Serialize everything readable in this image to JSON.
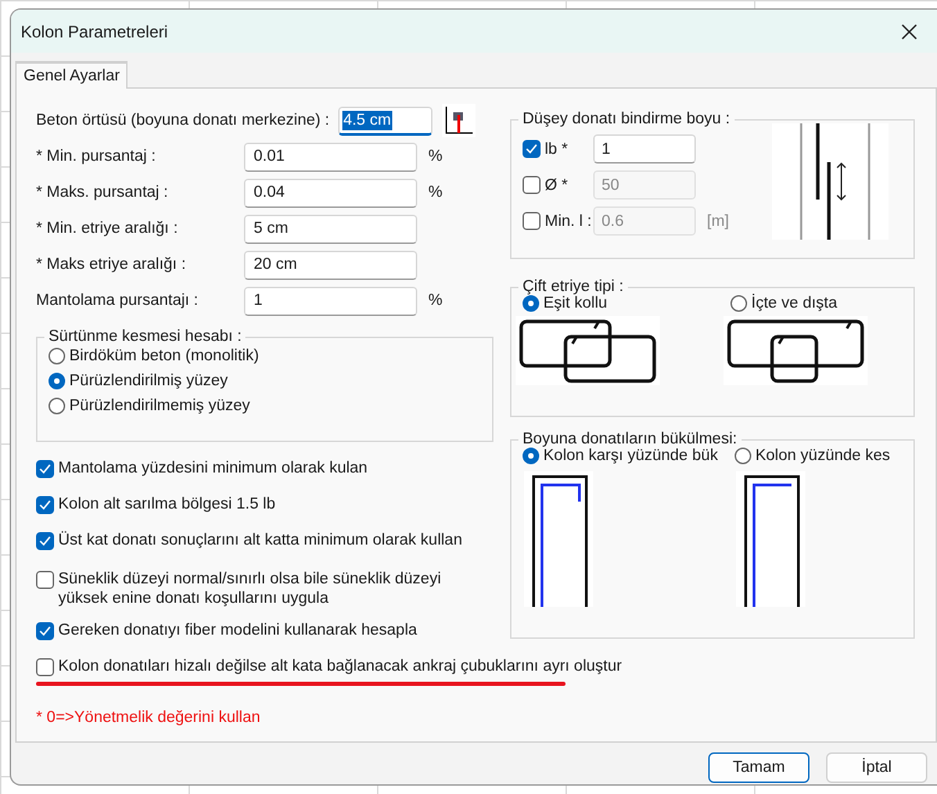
{
  "window": {
    "title": "Kolon Parametreleri"
  },
  "tabs": [
    {
      "label": "Genel Ayarlar",
      "selected": true
    }
  ],
  "fields": [
    {
      "label": "Beton örtüsü (boyuna donatı merkezine) :",
      "value": "4.5 cm",
      "selected": true,
      "kind": "cover"
    },
    {
      "label": "* Min.  pursantaj :",
      "value": "0.01",
      "unit": "%",
      "selected": false,
      "kind": "plain"
    },
    {
      "label": "* Maks. pursantaj :",
      "value": "0.04",
      "unit": "%",
      "selected": false,
      "kind": "plain"
    },
    {
      "label": "* Min. etriye aralığı :",
      "value": "5 cm",
      "selected": false,
      "kind": "plain"
    },
    {
      "label": "* Maks etriye aralığı :",
      "value": "20 cm",
      "selected": false,
      "kind": "plain"
    },
    {
      "label": "Mantolama pursantajı :",
      "value": "1",
      "unit": "%",
      "selected": false,
      "kind": "plain"
    }
  ],
  "friction": {
    "title": "Sürtünme kesmesi hesabı :",
    "options": [
      {
        "label": "Birdöküm beton (monolitik)",
        "selected": false
      },
      {
        "label": "Pürüzlendirilmiş yüzey",
        "selected": true
      },
      {
        "label": "Pürüzlendirilmemiş yüzey",
        "selected": false
      }
    ]
  },
  "checkboxes": [
    {
      "label": "Mantolama yüzdesini minimum olarak kulan",
      "checked": true,
      "underlined": false
    },
    {
      "label": "Kolon alt sarılma bölgesi 1.5 lb",
      "checked": true,
      "underlined": false
    },
    {
      "label": "Üst kat donatı sonuçlarını alt katta minimum olarak kullan",
      "checked": true,
      "underlined": false
    },
    {
      "label": "Süneklik düzeyi normal/sınırlı olsa bile süneklik düzeyi yüksek enine donatı koşullarını uygula",
      "checked": false,
      "underlined": false
    },
    {
      "label": "Gereken donatıyı fiber modelini kullanarak hesapla",
      "checked": true,
      "underlined": false
    },
    {
      "label": "Kolon donatıları hizalı değilse alt kata bağlanacak ankraj çubuklarını ayrı oluştur",
      "checked": false,
      "underlined": true
    }
  ],
  "note": "* 0=>Yönetmelik değerini kullan",
  "overlap": {
    "title": "Düşey donatı bindirme boyu :",
    "rows": [
      {
        "label": "lb *",
        "checked": true,
        "value": "1",
        "disabled": false
      },
      {
        "label": "Ø *",
        "checked": false,
        "value": "50",
        "disabled": true
      },
      {
        "label": "Min. l :",
        "checked": false,
        "value": "0.6",
        "disabled": true,
        "unit": "[m]"
      }
    ]
  },
  "stirrup": {
    "title": "Çift etriye tipi :",
    "options": [
      {
        "label": "Eşit kollu",
        "selected": true,
        "kind": "equal"
      },
      {
        "label": "İçte ve dışta",
        "selected": false,
        "kind": "inner"
      }
    ]
  },
  "bend": {
    "title": "Boyuna donatıların bükülmesi:",
    "options": [
      {
        "label": "Kolon karşı yüzünde bük",
        "selected": true,
        "kind": "bend"
      },
      {
        "label": "Kolon yüzünde kes",
        "selected": false,
        "kind": "cut"
      }
    ]
  },
  "buttons": [
    {
      "label": "Tamam",
      "default": true
    },
    {
      "label": "İptal",
      "default": false
    }
  ]
}
